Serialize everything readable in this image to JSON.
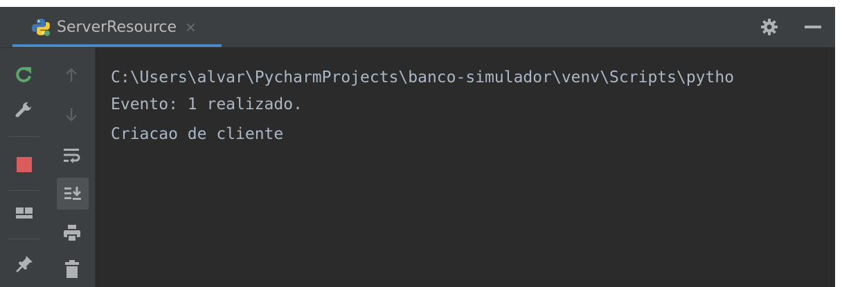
{
  "tab": {
    "label": "ServerResource",
    "close": "×",
    "icon": "python-icon"
  },
  "header": {
    "settings_icon": "gear-icon",
    "minimize_icon": "minimize-icon"
  },
  "toolbar_left": [
    {
      "icon": "rerun-icon"
    },
    {
      "icon": "wrench-icon"
    },
    {
      "icon": "stop-icon"
    },
    {
      "icon": "layout-icon"
    },
    {
      "icon": "pin-icon"
    }
  ],
  "toolbar_right": [
    {
      "icon": "arrow-up-icon"
    },
    {
      "icon": "arrow-down-icon"
    },
    {
      "icon": "soft-wrap-icon"
    },
    {
      "icon": "scroll-to-end-icon"
    },
    {
      "icon": "print-icon"
    },
    {
      "icon": "trash-icon"
    }
  ],
  "console": {
    "lines": [
      "C:\\Users\\alvar\\PycharmProjects\\banco-simulador\\venv\\Scripts\\pytho",
      "Evento: 1 realizado.",
      "Criacao de cliente"
    ]
  },
  "colors": {
    "accent": "#4a88c7",
    "stop": "#db5c5c",
    "rerun": "#59a869",
    "text": "#a9b7c6"
  }
}
